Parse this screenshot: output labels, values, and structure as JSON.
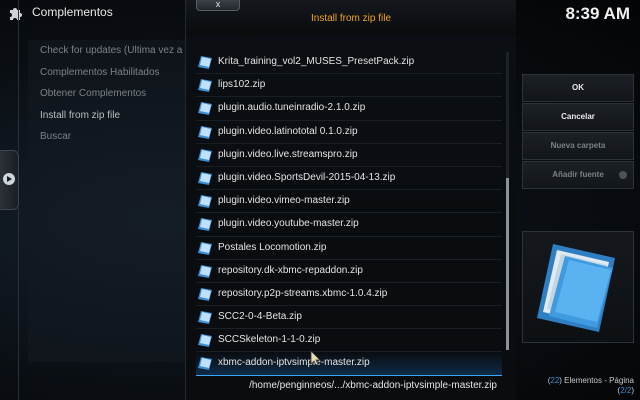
{
  "app": {
    "title": "Complementos"
  },
  "clock": "8:39 AM",
  "left_menu": {
    "items": [
      {
        "label": "Check for updates (Ultima vez a"
      },
      {
        "label": "Complementos Habilitados"
      },
      {
        "label": "Obtener Complementos"
      },
      {
        "label": "Install from zip file"
      },
      {
        "label": "Buscar"
      }
    ]
  },
  "dialog": {
    "title": "Install from zip file",
    "close_label": "x",
    "files": [
      "Krita_training_vol2_MUSES_PresetPack.zip",
      "lips102.zip",
      "plugin.audio.tuneinradio-2.1.0.zip",
      "plugin.video.latinototal 0.1.0.zip",
      "plugin.video.live.streamspro.zip",
      "plugin.video.SportsDevil-2015-04-13.zip",
      "plugin.video.vimeo-master.zip",
      "plugin.video.youtube-master.zip",
      "Postales Locomotion.zip",
      "repository.dk-xbmc-repaddon.zip",
      "repository.p2p-streams.xbmc-1.0.4.zip",
      "SCC2-0-4-Beta.zip",
      "SCCSkeleton-1-1-0.zip",
      "xbmc-addon-iptvsimple-master.zip"
    ],
    "selected_index": 13,
    "path": "/home/penginneos/.../xbmc-addon-iptvsimple-master.zip",
    "buttons": {
      "ok": "OK",
      "cancel": "Cancelar",
      "new_folder": "Nueva carpeta",
      "add_source": "Añadir fuente"
    },
    "page_info": {
      "count": "22",
      "items_label": "Elementos - Página",
      "page": "2/2"
    }
  },
  "colors": {
    "accent_orange": "#f0a31c",
    "selection_blue": "#3aa6ff",
    "count_blue": "#3a8fd9"
  },
  "icons": {
    "app": "puzzle-icon",
    "file": "zip-file-icon",
    "side": "chevron-right-icon"
  }
}
